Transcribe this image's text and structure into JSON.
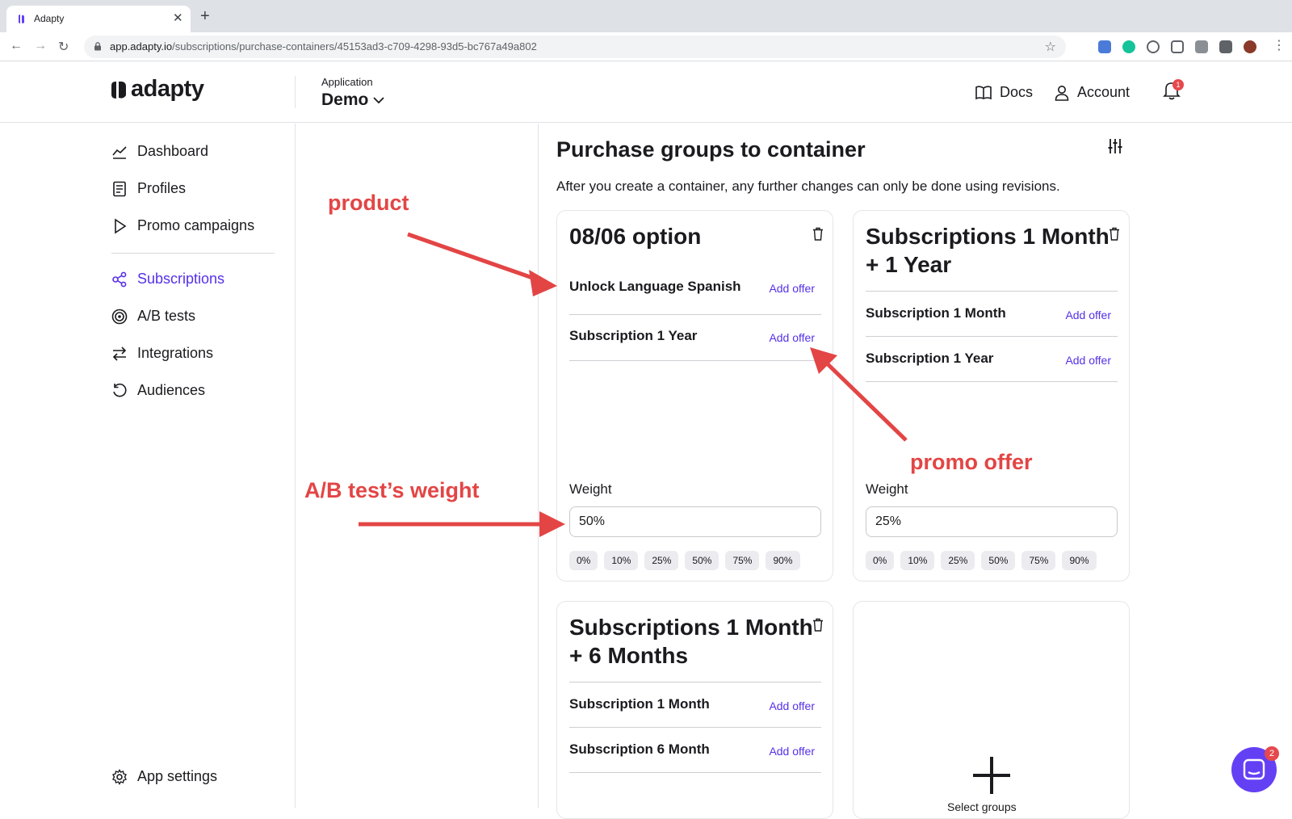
{
  "browser": {
    "tab_title": "Adapty",
    "new_tab_symbol": "+",
    "url_host": "app.adapty.io",
    "url_path": "/subscriptions/purchase-containers/45153ad3-c709-4298-93d5-bc767a49a802"
  },
  "header": {
    "logo_text": "adapty",
    "app_label": "Application",
    "app_name": "Demo",
    "docs_label": "Docs",
    "account_label": "Account",
    "notifications_count": "1"
  },
  "sidebar": {
    "items": [
      {
        "label": "Dashboard",
        "icon": "chart-line-icon"
      },
      {
        "label": "Profiles",
        "icon": "document-icon"
      },
      {
        "label": "Promo campaigns",
        "icon": "play-icon"
      },
      {
        "label": "Subscriptions",
        "icon": "share-nodes-icon",
        "active": true
      },
      {
        "label": "A/B tests",
        "icon": "target-icon"
      },
      {
        "label": "Integrations",
        "icon": "arrows-swap-icon"
      },
      {
        "label": "Audiences",
        "icon": "refresh-icon"
      }
    ],
    "settings_label": "App settings"
  },
  "main": {
    "title": "Purchase groups to container",
    "subtitle": "After you create a container, any further changes can only be done using revisions.",
    "add_offer_label": "Add offer",
    "weight_label": "Weight",
    "weight_presets": [
      "0%",
      "10%",
      "25%",
      "50%",
      "75%",
      "90%"
    ],
    "cards": [
      {
        "title": "08/06 option",
        "products": [
          "Unlock Language Spanish",
          "Subscription 1 Year"
        ],
        "weight": "50%"
      },
      {
        "title_line1": "Subscriptions 1 Month",
        "title_line2": "+ 1 Year",
        "products": [
          "Subscription 1 Month",
          "Subscription 1 Year"
        ],
        "weight": "25%"
      },
      {
        "title_line1": "Subscriptions 1 Month",
        "title_line2": "+ 6 Months",
        "products": [
          "Subscription 1 Month",
          "Subscription 6 Month"
        ]
      }
    ],
    "select_group_label": "Select groups"
  },
  "annotations": {
    "product": "product",
    "promo_offer": "promo offer",
    "ab_weight": "A/B test’s weight",
    "color": "#e34545"
  },
  "chat": {
    "badge_count": "2"
  },
  "colors": {
    "accent": "#5630e8",
    "annotation": "#e34545"
  }
}
